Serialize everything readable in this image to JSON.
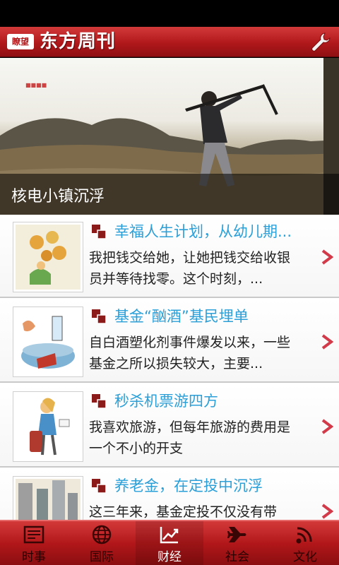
{
  "header": {
    "logo_text": "瞭望",
    "title": "东方周刊",
    "settings_icon": "wrench-icon"
  },
  "hero": {
    "caption": "核电小镇沉浮"
  },
  "articles": [
    {
      "title": "幸福人生计划，从幼儿期...",
      "desc": "我把钱交给她，让她把钱交给收银员并等待找零。这个时刻，..."
    },
    {
      "title": "基金“酗酒”基民埋单",
      "desc": "自白酒塑化剂事件爆发以来，一些基金之所以损失较大，主要..."
    },
    {
      "title": "秒杀机票游四方",
      "desc": "我喜欢旅游，但每年旅游的费用是一个不小的开支"
    },
    {
      "title": "养老金，在定投中沉浮",
      "desc": "这三年来，基金定投不仅没有带"
    }
  ],
  "tabs": [
    {
      "label": "时事",
      "icon": "newspaper-icon"
    },
    {
      "label": "国际",
      "icon": "globe-icon"
    },
    {
      "label": "财经",
      "icon": "chart-icon"
    },
    {
      "label": "社会",
      "icon": "airplane-icon"
    },
    {
      "label": "文化",
      "icon": "signal-icon"
    }
  ],
  "active_tab": "财经",
  "colors": {
    "accent_red": "#b0181b",
    "title_blue": "#2a9fd8"
  }
}
